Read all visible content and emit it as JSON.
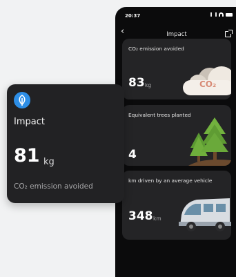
{
  "phone": {
    "status": {
      "time": "20:37"
    },
    "nav": {
      "title": "Impact"
    },
    "cards": [
      {
        "label": "CO₂ emission avoided",
        "value": "83",
        "unit": "kg",
        "art_label": "CO₂"
      },
      {
        "label": "Equivalent trees planted",
        "value": "4",
        "unit": ""
      },
      {
        "label": "km driven by an average vehicle",
        "value": "348",
        "unit": "km"
      }
    ]
  },
  "widget": {
    "title": "Impact",
    "value": "81",
    "unit": "kg",
    "caption": "CO₂ emission avoided",
    "icon": "leaf-icon",
    "accent": "#2d8ee6"
  },
  "colors": {
    "background": "#f1f2f3",
    "phone": "#0b0b0c",
    "card": "#242426",
    "widget": "#222224"
  }
}
